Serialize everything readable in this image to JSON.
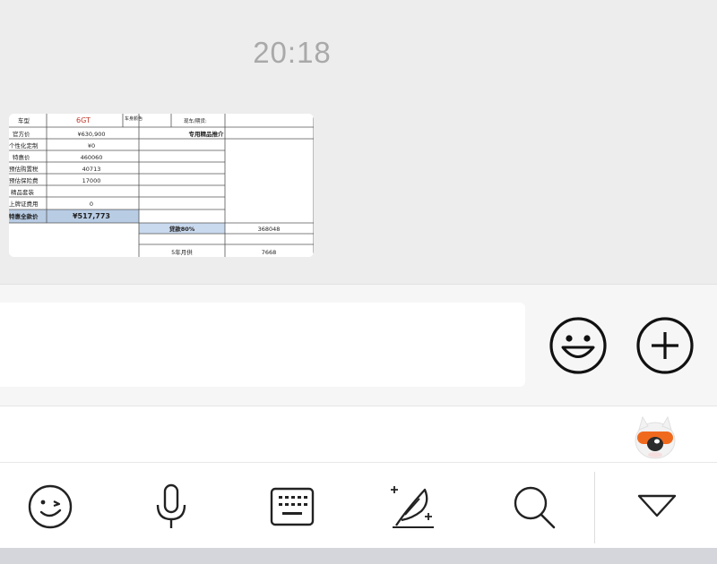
{
  "chat": {
    "timestamp": "20:18",
    "image_message": {
      "header": {
        "car_type_label": "车型",
        "car_type_value": "6GT",
        "body_color_label": "车身颜色",
        "stock_label": "现车/期货:"
      },
      "section_title": "专用精品推介",
      "rows": [
        {
          "label": "官方价",
          "value": "¥630,900"
        },
        {
          "label": "个性化定制",
          "value": "¥0"
        },
        {
          "label": "特惠价",
          "value": "460060"
        },
        {
          "label": "预估购置税",
          "value": "40713"
        },
        {
          "label": "预估保险费",
          "value": "17000"
        },
        {
          "label": "精品套装",
          "value": ""
        },
        {
          "label": "上牌证费用",
          "value": "0"
        },
        {
          "label": "特惠全款价",
          "value": "¥517,773"
        }
      ],
      "loan_label": "贷款80%",
      "loan_value": "368048",
      "monthly_label": "5年月供",
      "monthly_value": "7668"
    }
  },
  "input_bar": {
    "text_value": "",
    "emoji_button": "emoji-icon",
    "plus_button": "plus-icon"
  },
  "suggest_bar": {
    "mascot": "mascot-icon"
  },
  "ime_toolbar": {
    "tools": [
      "emoji-wink-icon",
      "microphone-icon",
      "keyboard-icon",
      "handwriting-icon",
      "search-icon",
      "collapse-triangle-icon"
    ]
  },
  "colors": {
    "background": "#ededed",
    "highlight_cell": "#b8cce4",
    "car_type_red": "#c0392b",
    "mascot_orange": "#f06a1e"
  }
}
